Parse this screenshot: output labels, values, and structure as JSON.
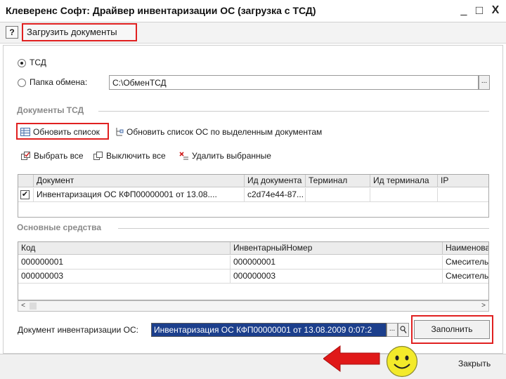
{
  "window": {
    "title": "Клеверенс Софт: Драйвер инвентаризации ОС (загрузка с ТСД)",
    "min_glyph": "_",
    "max_glyph": "□",
    "close_glyph": "X"
  },
  "toolbar": {
    "help_label": "?",
    "load_label": "Загрузить документы"
  },
  "source": {
    "option_tsd": "ТСД",
    "option_folder": "Папка обмена:",
    "folder_path": "С:\\ОбменТСД",
    "dots_label": "..."
  },
  "documents": {
    "section_title": "Документы ТСД",
    "refresh_label": "Обновить список",
    "refresh_selected_label": "Обновить список ОС по выделенным документам",
    "select_all_label": "Выбрать все",
    "deselect_all_label": "Выключить все",
    "delete_selected_label": "Удалить выбранные",
    "columns": [
      "Документ",
      "Ид документа",
      "Терминал",
      "Ид терминала",
      "IP"
    ],
    "rows": [
      {
        "checked": true,
        "check_glyph": "✔",
        "document": "Инвентаризация ОС КФП00000001 от 13.08....",
        "doc_id": "c2d74e44-87...",
        "terminal": "",
        "terminal_id": "",
        "ip": ""
      }
    ]
  },
  "assets": {
    "section_title": "Основные средства",
    "columns": [
      "Код",
      "ИнвентарныйНомер",
      "Наименова"
    ],
    "rows": [
      {
        "code": "000000001",
        "inv": "000000001",
        "name": "Смеситель"
      },
      {
        "code": "000000003",
        "inv": "000000003",
        "name": "Смеситель"
      }
    ],
    "scroll_left": "<",
    "scroll_right": ">"
  },
  "footer": {
    "doc_label": "Документ инвентаризации ОС:",
    "doc_value": "Инвентаризация ОС КФП00000001 от 13.08.2009 0:07:2",
    "dots_label": "...",
    "fill_label": "Заполнить",
    "close_label": "Закрыть"
  },
  "colors": {
    "highlight": "#e02020",
    "selection": "#1c3f8c",
    "arrow": "#e01818",
    "smiley": "#f3ea2a"
  }
}
